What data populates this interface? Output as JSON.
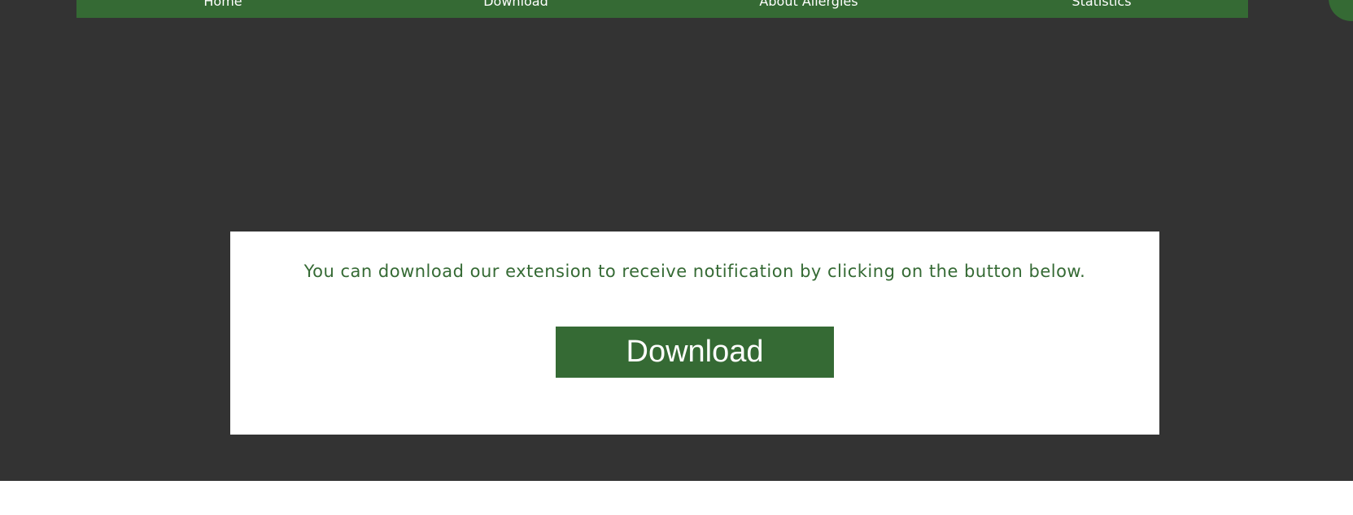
{
  "nav": {
    "items": [
      {
        "label": "Home"
      },
      {
        "label": "Download"
      },
      {
        "label": "About Allergies"
      },
      {
        "label": "Statistics"
      }
    ]
  },
  "colors": {
    "accent": "#356a34",
    "dark_background": "#333333",
    "card_background": "#ffffff"
  },
  "card": {
    "message": "You can download our extension to receive notification by clicking on the button below.",
    "button_label": "Download"
  }
}
